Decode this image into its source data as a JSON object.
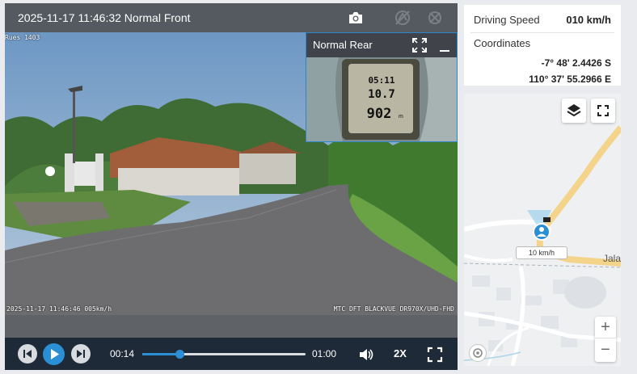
{
  "player": {
    "timestamp": "2025-11-17 11:46:32 Normal Front",
    "front_osd_top": "Rues 1403",
    "front_osd_bottom_left": "2025-11-17 11:46:46 005km/h",
    "front_osd_bottom_right": "MTC DFT BLACKVUE DR970X/UHD-FHD",
    "rear_label": "Normal Rear",
    "rear_display": {
      "line1": "05:11",
      "line2": "10.7",
      "line3": "902",
      "unit": "m"
    },
    "controls": {
      "current_time": "00:14",
      "duration": "01:00",
      "progress": 0.23,
      "speed": "2X"
    }
  },
  "info": {
    "speed_label": "Driving Speed",
    "speed_value": "010 km/h",
    "coords_label": "Coordinates",
    "lat": "-7° 48' 2.4426 S",
    "lon": "110° 37' 55.2966 E"
  },
  "map": {
    "speed_tag": "10 km/h",
    "road_label": "Jala",
    "zoom_in": "+",
    "zoom_out": "−"
  },
  "colors": {
    "accent": "#2b8fd6",
    "control_bar": "#1f2a38",
    "road": "#f3d48a"
  },
  "icons": [
    "camera-icon",
    "no-location-icon",
    "no-gps-icon",
    "expand-icon",
    "minimize-icon",
    "skip-back-icon",
    "play-icon",
    "skip-forward-icon",
    "volume-icon",
    "fullscreen-icon",
    "layers-icon",
    "map-fullscreen-icon",
    "vehicle-marker-icon",
    "locate-icon"
  ]
}
